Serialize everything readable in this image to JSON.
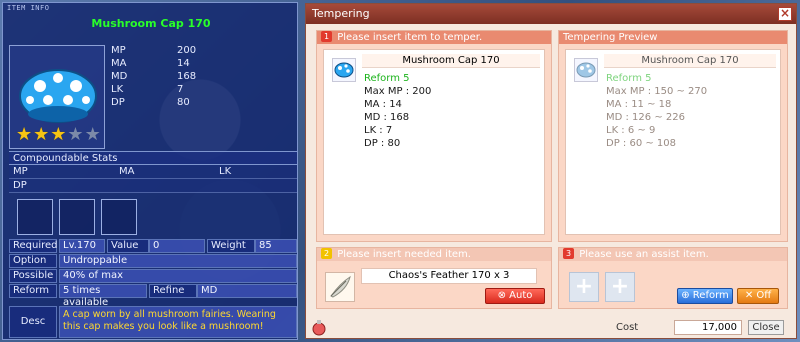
{
  "item_info": {
    "tag": "ITEM INFO",
    "title": "Mushroom Cap 170",
    "stats": [
      {
        "key": "MP",
        "value": "200"
      },
      {
        "key": "MA",
        "value": "14"
      },
      {
        "key": "MD",
        "value": "168"
      },
      {
        "key": "LK",
        "value": "7"
      },
      {
        "key": "DP",
        "value": "80"
      }
    ],
    "stars": {
      "filled": 3,
      "total": 5
    },
    "compoundable_label": "Compoundable Stats",
    "compound_row1": [
      "MP",
      "MA",
      "LK"
    ],
    "compound_row2": [
      "DP"
    ],
    "required": {
      "label": "Required",
      "level": "Lv.170",
      "value_label": "Value",
      "value": "0",
      "weight_label": "Weight",
      "weight": "85"
    },
    "option": {
      "label": "Option",
      "value": "Undroppable"
    },
    "possible": {
      "label": "Possible",
      "value": "40% of max"
    },
    "reform": {
      "label": "Reform",
      "value": "5 times available",
      "refine_label": "Refine",
      "refine_value": "MD"
    },
    "desc": {
      "label": "Desc",
      "text": "A cap worn by all mushroom fairies. Wearing this cap makes you look like a mushroom!"
    }
  },
  "tempering": {
    "title": "Tempering",
    "section1": {
      "num": "1",
      "label": "Please insert item to temper."
    },
    "current": {
      "name": "Mushroom Cap 170",
      "reform": "Reform 5",
      "lines": [
        "Max MP : 200",
        "MA : 14",
        "MD : 168",
        "LK : 7",
        "DP : 80"
      ]
    },
    "preview_label": "Tempering Preview",
    "preview": {
      "name": "Mushroom Cap 170",
      "reform": "Reform 5",
      "lines": [
        "Max MP : 150 ~ 270",
        "MA : 11 ~ 18",
        "MD : 126 ~ 226",
        "LK : 6 ~ 9",
        "DP : 60 ~ 108"
      ]
    },
    "section2": {
      "num": "2",
      "label": "Please insert needed item."
    },
    "needed_item": "Chaos's Feather 170 x 3",
    "auto_button": "Auto",
    "section3": {
      "num": "3",
      "label": "Please use an assist item."
    },
    "reform_button": "Reform",
    "off_button": "Off",
    "cost_label": "Cost",
    "cost_value": "17,000",
    "close_button": "Close"
  },
  "colors": {
    "accent_green": "#29ff29",
    "reform_green": "#1db41d",
    "desc_yellow": "#ffd930",
    "title_red": "#a64a3a"
  }
}
